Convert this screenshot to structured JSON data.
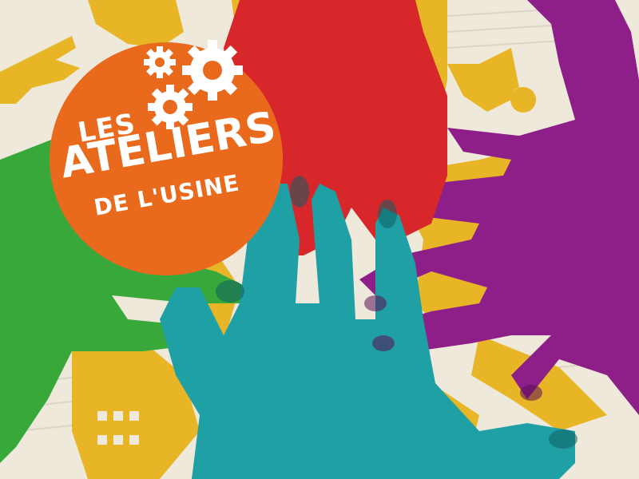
{
  "scene": {
    "description_tag": "poster-hands",
    "colors": {
      "paper": "#efe9dc",
      "yellow": "#e8b526",
      "red": "#d8272b",
      "purple": "#8e1f88",
      "green": "#38a83a",
      "teal": "#1fa0a4",
      "orange": "#ea6a1d",
      "white": "#ffffff"
    }
  },
  "logo": {
    "line1": "LES",
    "line2": "ATELIERS",
    "line3": "DE L'USINE",
    "icon": "gears-icon"
  }
}
